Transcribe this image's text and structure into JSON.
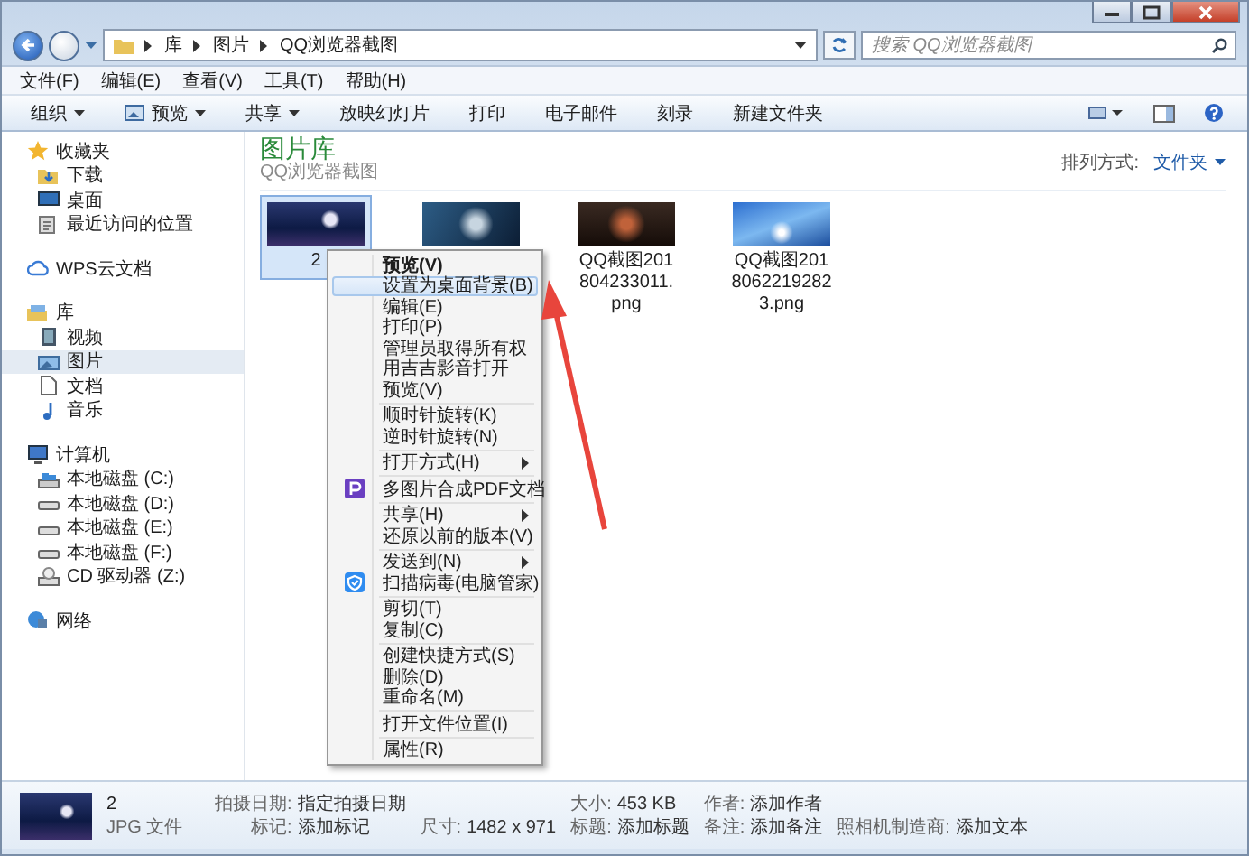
{
  "address": {
    "crumbs": [
      "库",
      "图片",
      "QQ浏览器截图"
    ],
    "search": {
      "placeholder": "搜索 QQ浏览器截图"
    }
  },
  "menubar": [
    "文件(F)",
    "编辑(E)",
    "查看(V)",
    "工具(T)",
    "帮助(H)"
  ],
  "toolbar": [
    {
      "label": "组织",
      "kind": "dropdown"
    },
    {
      "label": "预览",
      "kind": "preview"
    },
    {
      "label": "共享",
      "kind": "dropdown"
    },
    {
      "label": "放映幻灯片",
      "kind": "plain"
    },
    {
      "label": "打印",
      "kind": "plain"
    },
    {
      "label": "电子邮件",
      "kind": "plain"
    },
    {
      "label": "刻录",
      "kind": "plain"
    },
    {
      "label": "新建文件夹",
      "kind": "plain"
    }
  ],
  "sidebar": {
    "groups": [
      {
        "label": "收藏夹",
        "kind": "star",
        "selected": false,
        "children": [
          {
            "label": "下载",
            "kind": "download",
            "selected": false
          },
          {
            "label": "桌面",
            "kind": "desktop",
            "selected": false
          },
          {
            "label": "最近访问的位置",
            "kind": "recent",
            "selected": false
          }
        ]
      },
      {
        "label": "WPS云文档",
        "kind": "cloud",
        "selected": false
      },
      {
        "label": "库",
        "kind": "library",
        "selected": false,
        "children": [
          {
            "label": "视频",
            "kind": "video",
            "selected": false
          },
          {
            "label": "图片",
            "kind": "picture",
            "selected": true
          },
          {
            "label": "文档",
            "kind": "document",
            "selected": false
          },
          {
            "label": "音乐",
            "kind": "music",
            "selected": false
          }
        ]
      },
      {
        "label": "计算机",
        "kind": "computer",
        "selected": false,
        "children": [
          {
            "label": "本地磁盘 (C:)",
            "kind": "system-drive",
            "selected": false
          },
          {
            "label": "本地磁盘 (D:)",
            "kind": "drive",
            "selected": false
          },
          {
            "label": "本地磁盘 (E:)",
            "kind": "drive",
            "selected": false
          },
          {
            "label": "本地磁盘 (F:)",
            "kind": "drive",
            "selected": false
          },
          {
            "label": "CD 驱动器 (Z:)",
            "kind": "cd",
            "selected": false
          }
        ]
      },
      {
        "label": "网络",
        "kind": "network",
        "selected": false
      }
    ]
  },
  "library": {
    "title": "图片库",
    "subtitle": "QQ浏览器截图",
    "sort_label": "排列方式:",
    "sort_value": "文件夹"
  },
  "files": [
    {
      "name": "2",
      "selected": true,
      "kind": "moon"
    },
    {
      "kind": "creature",
      "selected": false
    },
    {
      "name": "QQ截图201804233011.png",
      "selected": false,
      "kind": "warrior"
    },
    {
      "name": "QQ截图20180622192823.png",
      "selected": false,
      "kind": "light"
    }
  ],
  "context_menu": [
    [
      {
        "label": "预览(V)",
        "default": true,
        "selected": false,
        "submenu": false,
        "kind": "text"
      },
      {
        "label": "设置为桌面背景(B)",
        "default": false,
        "selected": true,
        "submenu": false,
        "kind": "text"
      },
      {
        "label": "编辑(E)",
        "default": false,
        "selected": false,
        "submenu": false,
        "kind": "text"
      },
      {
        "label": "打印(P)",
        "default": false,
        "selected": false,
        "submenu": false,
        "kind": "text"
      },
      {
        "label": "管理员取得所有权",
        "default": false,
        "selected": false,
        "submenu": false,
        "kind": "text"
      },
      {
        "label": "用吉吉影音打开",
        "default": false,
        "selected": false,
        "submenu": false,
        "kind": "text"
      },
      {
        "label": "预览(V)",
        "default": false,
        "selected": false,
        "submenu": false,
        "kind": "text"
      }
    ],
    [
      {
        "label": "顺时针旋转(K)",
        "default": false,
        "selected": false,
        "submenu": false,
        "kind": "text"
      },
      {
        "label": "逆时针旋转(N)",
        "default": false,
        "selected": false,
        "submenu": false,
        "kind": "text"
      }
    ],
    [
      {
        "label": "打开方式(H)",
        "default": false,
        "selected": false,
        "submenu": true,
        "kind": "text"
      }
    ],
    [
      {
        "label": "多图片合成PDF文档",
        "default": false,
        "selected": false,
        "submenu": false,
        "kind": "pdf"
      }
    ],
    [
      {
        "label": "共享(H)",
        "default": false,
        "selected": false,
        "submenu": true,
        "kind": "text"
      },
      {
        "label": "还原以前的版本(V)",
        "default": false,
        "selected": false,
        "submenu": false,
        "kind": "text"
      }
    ],
    [
      {
        "label": "发送到(N)",
        "default": false,
        "selected": false,
        "submenu": true,
        "kind": "text"
      },
      {
        "label": "扫描病毒(电脑管家)",
        "default": false,
        "selected": false,
        "submenu": false,
        "kind": "shield"
      }
    ],
    [
      {
        "label": "剪切(T)",
        "default": false,
        "selected": false,
        "submenu": false,
        "kind": "text"
      },
      {
        "label": "复制(C)",
        "default": false,
        "selected": false,
        "submenu": false,
        "kind": "text"
      }
    ],
    [
      {
        "label": "创建快捷方式(S)",
        "default": false,
        "selected": false,
        "submenu": false,
        "kind": "text"
      },
      {
        "label": "删除(D)",
        "default": false,
        "selected": false,
        "submenu": false,
        "kind": "text"
      },
      {
        "label": "重命名(M)",
        "default": false,
        "selected": false,
        "submenu": false,
        "kind": "text"
      }
    ],
    [
      {
        "label": "打开文件位置(I)",
        "default": false,
        "selected": false,
        "submenu": false,
        "kind": "text"
      }
    ],
    [
      {
        "label": "属性(R)",
        "default": false,
        "selected": false,
        "submenu": false,
        "kind": "text"
      }
    ]
  ],
  "details": {
    "name": "2",
    "type": "JPG 文件",
    "columns": [
      [
        {
          "label": "拍摄日期:",
          "value": "指定拍摄日期"
        },
        {
          "label": "标记:",
          "value": "添加标记"
        }
      ],
      [
        {
          "label": "尺寸:",
          "value": "1482 x 971"
        }
      ],
      [
        {
          "label": "大小:",
          "value": "453 KB"
        },
        {
          "label": "标题:",
          "value": "添加标题"
        }
      ],
      [
        {
          "label": "作者:",
          "value": "添加作者"
        },
        {
          "label": "备注:",
          "value": "添加备注"
        }
      ],
      [
        {
          "label": "照相机制造商:",
          "value": "添加文本"
        }
      ]
    ]
  }
}
